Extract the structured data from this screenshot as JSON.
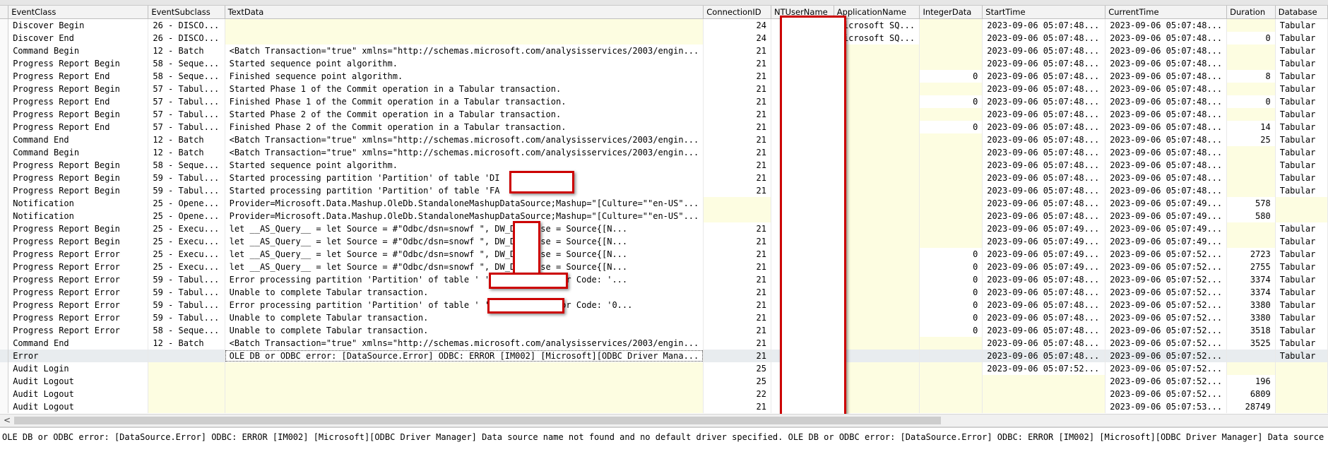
{
  "columns": [
    "EventClass",
    "EventSubclass",
    "TextData",
    "ConnectionID",
    "NTUserName",
    "ApplicationName",
    "IntegerData",
    "StartTime",
    "CurrentTime",
    "Duration",
    "Database"
  ],
  "rows": [
    {
      "event_class": "Discover Begin",
      "event_subclass": "26 - DISCO...",
      "text_data": "",
      "connection_id": "24",
      "app_name": "Microsoft SQ...",
      "integer_data": "",
      "start_time": "2023-09-06 05:07:48...",
      "current_time": "2023-09-06 05:07:48...",
      "duration": "",
      "database": "Tabular"
    },
    {
      "event_class": "Discover End",
      "event_subclass": "26 - DISCO...",
      "text_data": "",
      "connection_id": "24",
      "app_name": "Microsoft SQ...",
      "integer_data": "",
      "start_time": "2023-09-06 05:07:48...",
      "current_time": "2023-09-06 05:07:48...",
      "duration": "0",
      "database": "Tabular"
    },
    {
      "event_class": "Command Begin",
      "event_subclass": "12 - Batch",
      "text_data": "<Batch Transaction=\"true\" xmlns=\"http://schemas.microsoft.com/analysisservices/2003/engin...",
      "connection_id": "21",
      "app_name": "",
      "integer_data": "",
      "start_time": "2023-09-06 05:07:48...",
      "current_time": "2023-09-06 05:07:48...",
      "duration": "",
      "database": "Tabular"
    },
    {
      "event_class": "Progress Report Begin",
      "event_subclass": "58 - Seque...",
      "text_data": "Started sequence point algorithm.",
      "connection_id": "21",
      "app_name": "",
      "integer_data": "",
      "start_time": "2023-09-06 05:07:48...",
      "current_time": "2023-09-06 05:07:48...",
      "duration": "",
      "database": "Tabular"
    },
    {
      "event_class": "Progress Report End",
      "event_subclass": "58 - Seque...",
      "text_data": "Finished sequence point algorithm.",
      "connection_id": "21",
      "app_name": "",
      "integer_data": "0",
      "start_time": "2023-09-06 05:07:48...",
      "current_time": "2023-09-06 05:07:48...",
      "duration": "8",
      "database": "Tabular"
    },
    {
      "event_class": "Progress Report Begin",
      "event_subclass": "57 - Tabul...",
      "text_data": "Started Phase 1 of the Commit operation in a Tabular transaction.",
      "connection_id": "21",
      "app_name": "",
      "integer_data": "",
      "start_time": "2023-09-06 05:07:48...",
      "current_time": "2023-09-06 05:07:48...",
      "duration": "",
      "database": "Tabular"
    },
    {
      "event_class": "Progress Report End",
      "event_subclass": "57 - Tabul...",
      "text_data": "Finished Phase 1 of the Commit operation in a Tabular transaction.",
      "connection_id": "21",
      "app_name": "",
      "integer_data": "0",
      "start_time": "2023-09-06 05:07:48...",
      "current_time": "2023-09-06 05:07:48...",
      "duration": "0",
      "database": "Tabular"
    },
    {
      "event_class": "Progress Report Begin",
      "event_subclass": "57 - Tabul...",
      "text_data": "Started Phase 2 of the Commit operation in a Tabular transaction.",
      "connection_id": "21",
      "app_name": "",
      "integer_data": "",
      "start_time": "2023-09-06 05:07:48...",
      "current_time": "2023-09-06 05:07:48...",
      "duration": "",
      "database": "Tabular"
    },
    {
      "event_class": "Progress Report End",
      "event_subclass": "57 - Tabul...",
      "text_data": "Finished Phase 2 of the Commit operation in a Tabular transaction.",
      "connection_id": "21",
      "app_name": "",
      "integer_data": "0",
      "start_time": "2023-09-06 05:07:48...",
      "current_time": "2023-09-06 05:07:48...",
      "duration": "14",
      "database": "Tabular"
    },
    {
      "event_class": "Command End",
      "event_subclass": "12 - Batch",
      "text_data": "<Batch Transaction=\"true\" xmlns=\"http://schemas.microsoft.com/analysisservices/2003/engin...",
      "connection_id": "21",
      "app_name": "",
      "integer_data": "",
      "start_time": "2023-09-06 05:07:48...",
      "current_time": "2023-09-06 05:07:48...",
      "duration": "25",
      "database": "Tabular"
    },
    {
      "event_class": "Command Begin",
      "event_subclass": "12 - Batch",
      "text_data": "<Batch Transaction=\"true\" xmlns=\"http://schemas.microsoft.com/analysisservices/2003/engin...",
      "connection_id": "21",
      "app_name": "",
      "integer_data": "",
      "start_time": "2023-09-06 05:07:48...",
      "current_time": "2023-09-06 05:07:48...",
      "duration": "",
      "database": "Tabular"
    },
    {
      "event_class": "Progress Report Begin",
      "event_subclass": "58 - Seque...",
      "text_data": "Started sequence point algorithm.",
      "connection_id": "21",
      "app_name": "",
      "integer_data": "",
      "start_time": "2023-09-06 05:07:48...",
      "current_time": "2023-09-06 05:07:48...",
      "duration": "",
      "database": "Tabular"
    },
    {
      "event_class": "Progress Report Begin",
      "event_subclass": "59 - Tabul...",
      "text_data": "Started processing partition 'Partition' of table 'DI",
      "connection_id": "21",
      "app_name": "",
      "integer_data": "",
      "start_time": "2023-09-06 05:07:48...",
      "current_time": "2023-09-06 05:07:48...",
      "duration": "",
      "database": "Tabular"
    },
    {
      "event_class": "Progress Report Begin",
      "event_subclass": "59 - Tabul...",
      "text_data": "Started processing partition 'Partition' of table 'FA",
      "connection_id": "21",
      "app_name": "",
      "integer_data": "",
      "start_time": "2023-09-06 05:07:48...",
      "current_time": "2023-09-06 05:07:48...",
      "duration": "",
      "database": "Tabular"
    },
    {
      "event_class": "Notification",
      "event_subclass": "25 - Opene...",
      "text_data": "Provider=Microsoft.Data.Mashup.OleDb.StandaloneMashupDataSource;Mashup=\"[Culture=\"\"en-US\"...",
      "connection_id": "",
      "app_name": "",
      "integer_data": "",
      "start_time": "2023-09-06 05:07:48...",
      "current_time": "2023-09-06 05:07:49...",
      "duration": "578",
      "database": ""
    },
    {
      "event_class": "Notification",
      "event_subclass": "25 - Opene...",
      "text_data": "Provider=Microsoft.Data.Mashup.OleDb.StandaloneMashupDataSource;Mashup=\"[Culture=\"\"en-US\"...",
      "connection_id": "",
      "app_name": "",
      "integer_data": "",
      "start_time": "2023-09-06 05:07:48...",
      "current_time": "2023-09-06 05:07:49...",
      "duration": "580",
      "database": ""
    },
    {
      "event_class": "Progress Report Begin",
      "event_subclass": "25 - Execu...",
      "text_data": "let __AS_Query__ =  let     Source = #\"Odbc/dsn=snowf         \",     DW_Database = Source{[N...",
      "connection_id": "21",
      "app_name": "",
      "integer_data": "",
      "start_time": "2023-09-06 05:07:49...",
      "current_time": "2023-09-06 05:07:49...",
      "duration": "",
      "database": "Tabular"
    },
    {
      "event_class": "Progress Report Begin",
      "event_subclass": "25 - Execu...",
      "text_data": "let __AS_Query__ =  let     Source = #\"Odbc/dsn=snowf         \",     DW_Database = Source{[N...",
      "connection_id": "21",
      "app_name": "",
      "integer_data": "",
      "start_time": "2023-09-06 05:07:49...",
      "current_time": "2023-09-06 05:07:49...",
      "duration": "",
      "database": "Tabular"
    },
    {
      "event_class": "Progress Report Error",
      "event_subclass": "25 - Execu...",
      "text_data": "let __AS_Query__ =  let     Source = #\"Odbc/dsn=snowf         \",     DW_Database = Source{[N...",
      "connection_id": "21",
      "app_name": "",
      "integer_data": "0",
      "start_time": "2023-09-06 05:07:49...",
      "current_time": "2023-09-06 05:07:52...",
      "duration": "2723",
      "database": "Tabular"
    },
    {
      "event_class": "Progress Report Error",
      "event_subclass": "25 - Execu...",
      "text_data": "let __AS_Query__ =  let     Source = #\"Odbc/dsn=snowf         \",     DW_Database = Source{[N...",
      "connection_id": "21",
      "app_name": "",
      "integer_data": "0",
      "start_time": "2023-09-06 05:07:49...",
      "current_time": "2023-09-06 05:07:52...",
      "duration": "2755",
      "database": "Tabular"
    },
    {
      "event_class": "Progress Report Error",
      "event_subclass": "59 - Tabul...",
      "text_data": "Error processing partition 'Partition' of table '               ' [Internal Error Code: '...",
      "connection_id": "21",
      "app_name": "",
      "integer_data": "0",
      "start_time": "2023-09-06 05:07:48...",
      "current_time": "2023-09-06 05:07:52...",
      "duration": "3374",
      "database": "Tabular"
    },
    {
      "event_class": "Progress Report Error",
      "event_subclass": "59 - Tabul...",
      "text_data": "Unable to complete Tabular transaction.",
      "connection_id": "21",
      "app_name": "",
      "integer_data": "0",
      "start_time": "2023-09-06 05:07:48...",
      "current_time": "2023-09-06 05:07:52...",
      "duration": "3374",
      "database": "Tabular"
    },
    {
      "event_class": "Progress Report Error",
      "event_subclass": "59 - Tabul...",
      "text_data": "Error processing partition 'Partition' of table '               ' [Internal Error Code: '0...",
      "connection_id": "21",
      "app_name": "",
      "integer_data": "0",
      "start_time": "2023-09-06 05:07:48...",
      "current_time": "2023-09-06 05:07:52...",
      "duration": "3380",
      "database": "Tabular"
    },
    {
      "event_class": "Progress Report Error",
      "event_subclass": "59 - Tabul...",
      "text_data": "Unable to complete Tabular transaction.",
      "connection_id": "21",
      "app_name": "",
      "integer_data": "0",
      "start_time": "2023-09-06 05:07:48...",
      "current_time": "2023-09-06 05:07:52...",
      "duration": "3380",
      "database": "Tabular"
    },
    {
      "event_class": "Progress Report Error",
      "event_subclass": "58 - Seque...",
      "text_data": "Unable to complete Tabular transaction.",
      "connection_id": "21",
      "app_name": "",
      "integer_data": "0",
      "start_time": "2023-09-06 05:07:48...",
      "current_time": "2023-09-06 05:07:52...",
      "duration": "3518",
      "database": "Tabular"
    },
    {
      "event_class": "Command End",
      "event_subclass": "12 - Batch",
      "text_data": "<Batch Transaction=\"true\" xmlns=\"http://schemas.microsoft.com/analysisservices/2003/engin...",
      "connection_id": "21",
      "app_name": "",
      "integer_data": "",
      "start_time": "2023-09-06 05:07:48...",
      "current_time": "2023-09-06 05:07:52...",
      "duration": "3525",
      "database": "Tabular"
    },
    {
      "event_class": "Error",
      "event_subclass": "",
      "text_data": "OLE DB or ODBC error: [DataSource.Error] ODBC: ERROR [IM002] [Microsoft][ODBC Driver Mana...",
      "connection_id": "21",
      "app_name": "",
      "integer_data": "",
      "start_time": "2023-09-06 05:07:48...",
      "current_time": "2023-09-06 05:07:52...",
      "duration": "",
      "database": "Tabular",
      "selected": true
    },
    {
      "event_class": "Audit Login",
      "event_subclass": "",
      "text_data": "",
      "connection_id": "25",
      "app_name": "",
      "integer_data": "",
      "start_time": "2023-09-06 05:07:52...",
      "current_time": "2023-09-06 05:07:52...",
      "duration": "",
      "database": ""
    },
    {
      "event_class": "Audit Logout",
      "event_subclass": "",
      "text_data": "",
      "connection_id": "25",
      "app_name": "",
      "integer_data": "",
      "start_time": "",
      "current_time": "2023-09-06 05:07:52...",
      "duration": "196",
      "database": ""
    },
    {
      "event_class": "Audit Logout",
      "event_subclass": "",
      "text_data": "",
      "connection_id": "22",
      "app_name": "",
      "integer_data": "",
      "start_time": "",
      "current_time": "2023-09-06 05:07:52...",
      "duration": "6809",
      "database": ""
    },
    {
      "event_class": "Audit Logout",
      "event_subclass": "",
      "text_data": "",
      "connection_id": "21",
      "app_name": "",
      "integer_data": "",
      "start_time": "",
      "current_time": "2023-09-06 05:07:53...",
      "duration": "28749",
      "database": ""
    }
  ],
  "scrollbar": {
    "left_arrow": "<"
  },
  "detail_text": "OLE DB or ODBC error: [DataSource.Error] ODBC: ERROR [IM002] [Microsoft][ODBC Driver Manager] Data source name not found and no default driver specified. OLE DB or ODBC error: [DataSource.Error] ODBC: ERROR [IM002] [Microsoft][ODBC Driver Manager] Data source name not found and no default driver specified."
}
